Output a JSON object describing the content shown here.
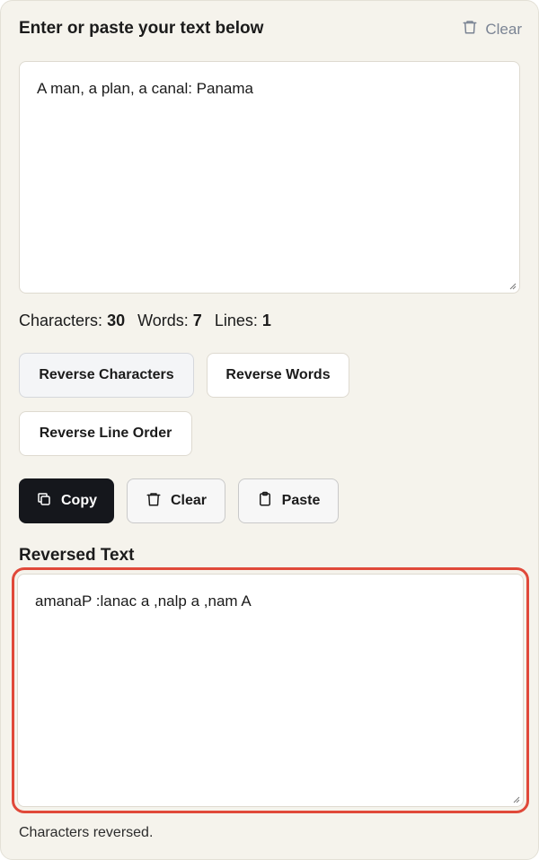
{
  "header": {
    "title": "Enter or paste your text below",
    "clear_label": "Clear"
  },
  "input": {
    "value": "A man, a plan, a canal: Panama"
  },
  "stats": {
    "characters_label": "Characters:",
    "characters_value": "30",
    "words_label": "Words:",
    "words_value": "7",
    "lines_label": "Lines:",
    "lines_value": "1"
  },
  "modes": {
    "reverse_characters": "Reverse Characters",
    "reverse_words": "Reverse Words",
    "reverse_line_order": "Reverse Line Order",
    "active": "reverse_characters"
  },
  "actions": {
    "copy": "Copy",
    "clear": "Clear",
    "paste": "Paste"
  },
  "output": {
    "title": "Reversed Text",
    "value": "amanaP :lanac a ,nalp a ,nam A"
  },
  "status": "Characters reversed.",
  "colors": {
    "panel_bg": "#f5f3ec",
    "accent_outline": "#e0493a",
    "dark_button": "#15171c"
  },
  "icons": {
    "header_clear": "trash-icon",
    "copy": "copy-icon",
    "clear": "trash-icon",
    "paste": "clipboard-icon"
  }
}
